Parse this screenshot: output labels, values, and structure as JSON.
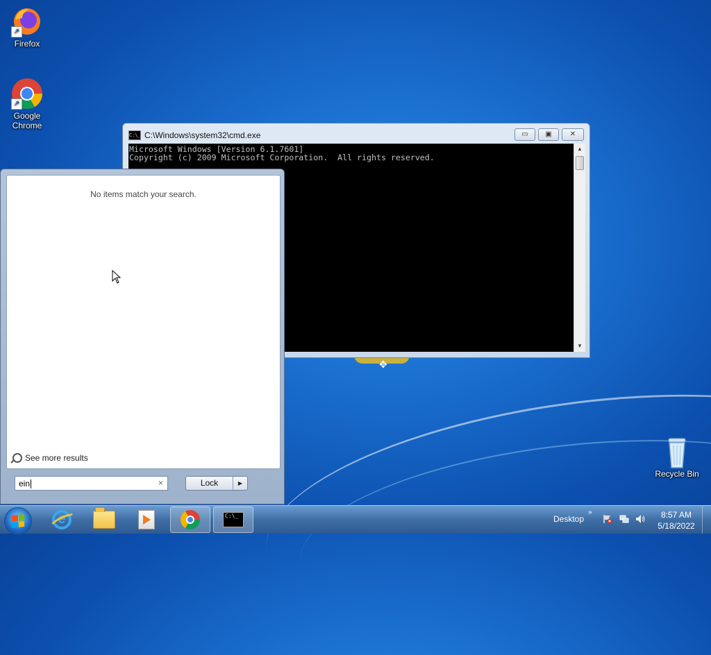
{
  "desktop": {
    "icons": [
      {
        "name": "firefox",
        "label": "Firefox"
      },
      {
        "name": "chrome",
        "label": "Google Chrome"
      },
      {
        "name": "recycle-bin",
        "label": "Recycle Bin"
      }
    ]
  },
  "cmd_window": {
    "title": "C:\\Windows\\system32\\cmd.exe",
    "lines": [
      "Microsoft Windows [Version 6.1.7601]",
      "Copyright (c) 2009 Microsoft Corporation.  All rights reserved."
    ],
    "controls": {
      "minimize": "▭",
      "maximize": "▣",
      "close": "✕"
    }
  },
  "start_menu": {
    "no_results": "No items match your search.",
    "see_more": "See more results",
    "search_value": "ein",
    "clear_symbol": "×",
    "lock_label": "Lock",
    "lock_arrow": "▶"
  },
  "taskbar": {
    "tray_desktop": "Desktop",
    "tray_chevron": "»",
    "clock_time": "8:57 AM",
    "clock_date": "5/18/2022",
    "cmd_icon_text": "C:\\_"
  }
}
